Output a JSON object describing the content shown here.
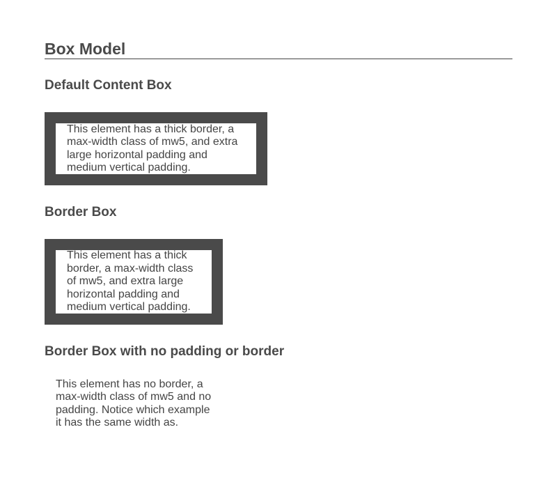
{
  "page": {
    "title": "Box Model"
  },
  "sections": [
    {
      "heading": "Default Content Box",
      "text": "This element has a thick border, a max-width class of mw5, and extra large horizontal padding and medium vertical padding."
    },
    {
      "heading": "Border Box",
      "text": "This element has a thick border, a max-width class of mw5, and extra large horizontal padding and medium vertical padding."
    },
    {
      "heading": "Border Box with no padding or border",
      "text": "This element has no border, a max-width class of mw5 and no padding. Notice which example it has the same width as."
    }
  ],
  "colors": {
    "text": "#444444",
    "border": "#4a4a4a",
    "background": "#ffffff"
  }
}
